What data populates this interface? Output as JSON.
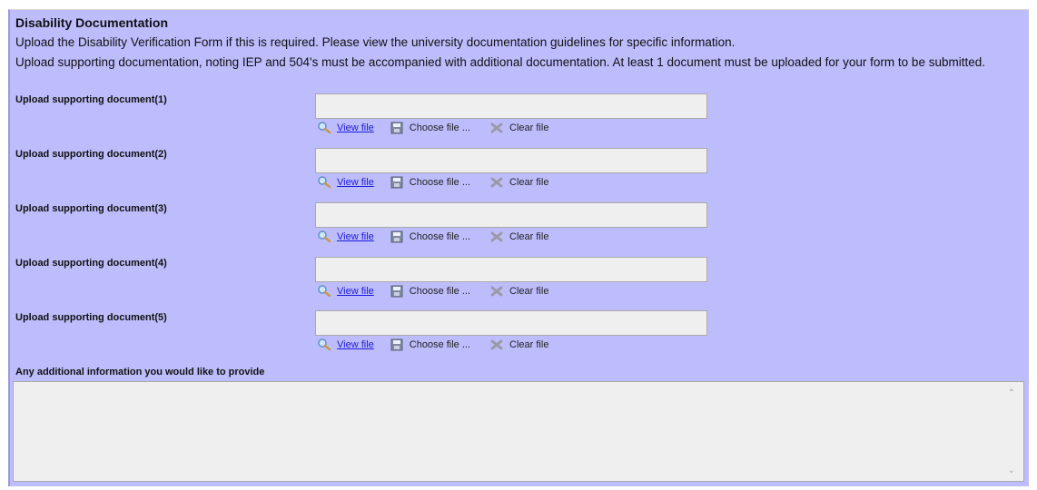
{
  "section": {
    "title": "Disability Documentation",
    "intro_line1": "Upload the Disability Verification Form if this is required. Please view the university documentation guidelines for specific information.",
    "intro_line2": "Upload supporting documentation, noting IEP and 504's must be accompanied with additional documentation. At least 1 document must be uploaded for your form to be submitted."
  },
  "uploads": [
    {
      "label": "Upload supporting document(1)",
      "value": ""
    },
    {
      "label": "Upload supporting document(2)",
      "value": ""
    },
    {
      "label": "Upload supporting document(3)",
      "value": ""
    },
    {
      "label": "Upload supporting document(4)",
      "value": ""
    },
    {
      "label": "Upload supporting document(5)",
      "value": ""
    }
  ],
  "actions": {
    "view_label": "View file",
    "choose_label": "Choose file ...",
    "clear_label": "Clear file"
  },
  "additional": {
    "label": "Any additional information you would like to provide",
    "value": ""
  },
  "colors": {
    "panel_bg": "#bdbdfd",
    "link": "#1a1adf",
    "field_bg": "#efefef"
  },
  "icons": {
    "view": "magnifier-icon",
    "choose": "floppy-disk-icon",
    "clear": "clear-x-icon"
  }
}
